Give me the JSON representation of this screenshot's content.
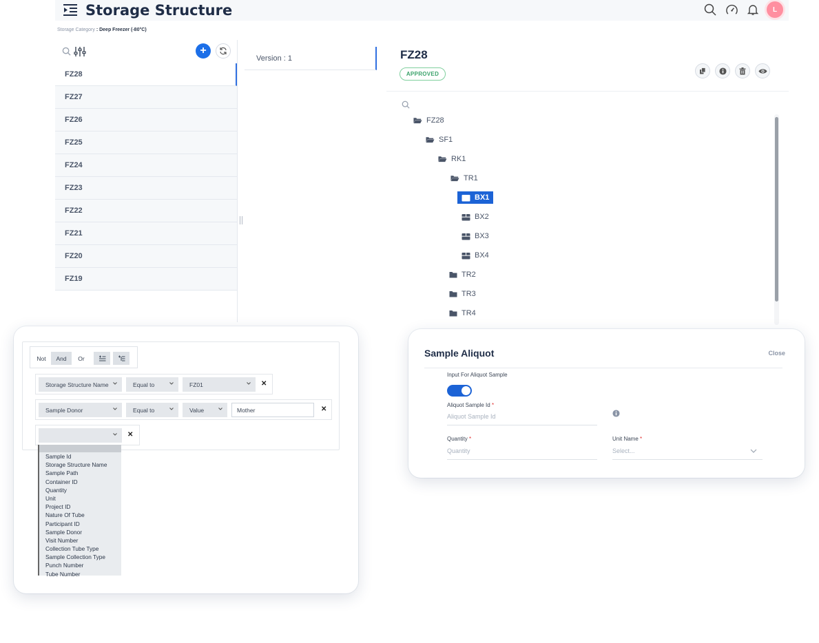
{
  "header": {
    "title": "Storage Structure",
    "avatar_initial": "L",
    "icons": [
      "menu-collapse-icon",
      "search-icon",
      "speedometer-icon",
      "bell-icon"
    ]
  },
  "breadcrumb": {
    "label": "Storage Category",
    "value": ": Deep Freezer (-80°C)"
  },
  "structure_list": {
    "items": [
      "FZ28",
      "FZ27",
      "FZ26",
      "FZ25",
      "FZ24",
      "FZ23",
      "FZ22",
      "FZ21",
      "FZ20",
      "FZ19"
    ],
    "selected": "FZ28"
  },
  "version": {
    "label": "Version : 1"
  },
  "detail": {
    "title": "FZ28",
    "status": "APPROVED",
    "status_color": "#3aa26a",
    "accent_color": "#1c63d6"
  },
  "tree": {
    "nodes": [
      {
        "label": "FZ28",
        "icon": "folder-open-icon"
      },
      {
        "label": "SF1",
        "icon": "folder-open-icon"
      },
      {
        "label": "RK1",
        "icon": "folder-open-icon"
      },
      {
        "label": "TR1",
        "icon": "folder-open-icon"
      },
      {
        "label": "BX1",
        "icon": "box-icon",
        "selected": true
      },
      {
        "label": "BX2",
        "icon": "box-icon"
      },
      {
        "label": "BX3",
        "icon": "box-icon"
      },
      {
        "label": "BX4",
        "icon": "box-icon"
      },
      {
        "label": "TR2",
        "icon": "folder-icon"
      },
      {
        "label": "TR3",
        "icon": "folder-icon"
      },
      {
        "label": "TR4",
        "icon": "folder-icon"
      }
    ]
  },
  "query_builder": {
    "ops": {
      "not": "Not",
      "and": "And",
      "or": "Or",
      "active": "And"
    },
    "rule1": {
      "field": "Storage Structure Name",
      "operator": "Equal to",
      "value": "FZ01"
    },
    "rule2": {
      "field": "Sample Donor",
      "operator": "Equal to",
      "value_type": "Value",
      "value": "Mother"
    },
    "field_options": [
      "Sample Id",
      "Storage Structure Name",
      "Sample Path",
      "Container ID",
      "Quantity",
      "Unit",
      "Project ID",
      "Nature Of Tube",
      "Participant ID",
      "Sample Donor",
      "Visit Number",
      "Collection Tube Type",
      "Sample Collection Type",
      "Punch Number",
      "Tube Number"
    ]
  },
  "aliquot": {
    "title": "Sample Aliquot",
    "close": "Close",
    "toggle_label": "Input For Aliquot Sample",
    "toggle_on": true,
    "aliquot_id_label": "Aliquot Sample Id",
    "aliquot_id_placeholder": "Aliquot Sample Id",
    "quantity_label": "Quantity",
    "quantity_placeholder": "Quantity",
    "unit_label": "Unit Name",
    "unit_placeholder": "Select...",
    "required_mark": "*"
  }
}
